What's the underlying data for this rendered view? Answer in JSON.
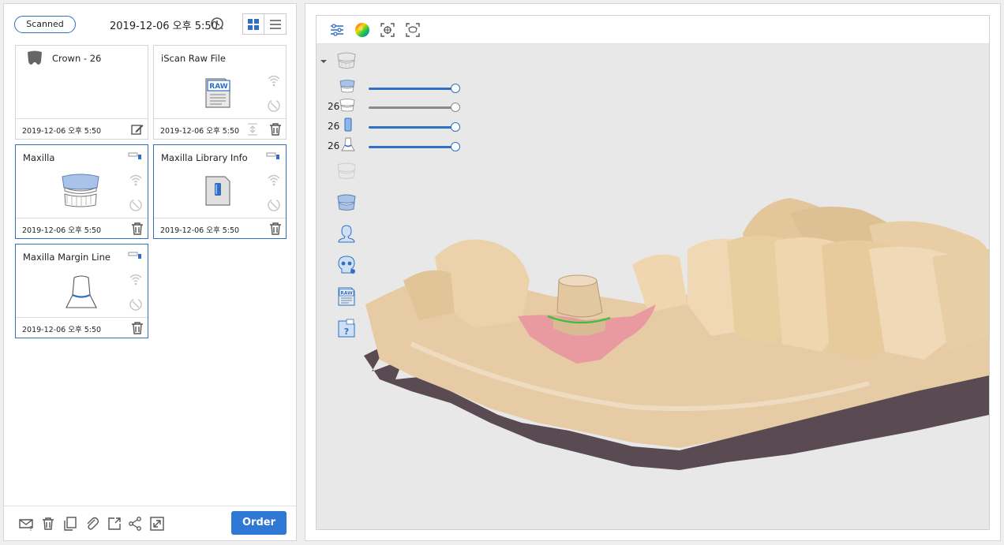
{
  "header": {
    "status_label": "Scanned",
    "date": "2019-12-06 오후 5:50"
  },
  "cards": [
    {
      "title": "Crown - 26",
      "date": "2019-12-06 오후 5:50"
    },
    {
      "title": "iScan Raw File",
      "date": "2019-12-06 오후 5:50",
      "thumb_label": "RAW"
    },
    {
      "title": "Maxilla",
      "date": "2019-12-06 오후 5:50"
    },
    {
      "title": "Maxilla Library Info",
      "date": "2019-12-06 오후 5:50"
    },
    {
      "title": "Maxilla Margin Line",
      "date": "2019-12-06 오후 5:50"
    }
  ],
  "footer": {
    "order_label": "Order"
  },
  "layers": [
    {
      "number": "",
      "slider": 1.0,
      "color": "#2f6fc4"
    },
    {
      "number": "26",
      "slider": 1.0,
      "color": "#8a8a8a"
    },
    {
      "number": "26",
      "slider": 1.0,
      "color": "#2f6fc4"
    },
    {
      "number": "26",
      "slider": 1.0,
      "color": "#2f6fc4"
    }
  ],
  "tree_icons": {
    "raw_label": "RAW",
    "help_label": "?"
  },
  "colors": {
    "accent": "#2f6fc4",
    "order_button": "#2f78d6",
    "gum": "#e89aa0",
    "margin_line": "#3fbf3f"
  },
  "icons": [
    "clock-icon",
    "grid-view-icon",
    "list-view-icon",
    "tooth-icon",
    "edit-icon",
    "trash-icon",
    "scan-icon",
    "wireless-icon",
    "sync-icon",
    "settings-sliders-icon",
    "color-wheel-icon",
    "focus-icon",
    "fit-view-icon",
    "mail-help-icon",
    "copy-icon",
    "attach-icon",
    "export-icon",
    "share-icon",
    "expand-icon"
  ]
}
